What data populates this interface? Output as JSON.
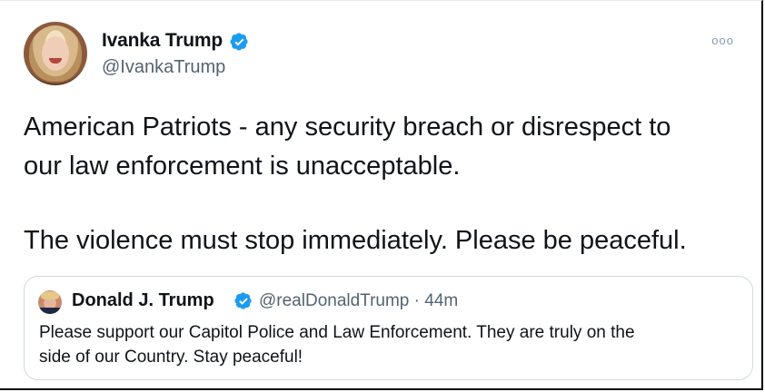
{
  "author": {
    "name": "Ivanka Trump",
    "handle": "@IvankaTrump",
    "verified": true
  },
  "more_icon": "ooo",
  "tweet": {
    "paragraph1_line1": "American Patriots - any security breach or disrespect to",
    "paragraph1_line2": "our law enforcement is unacceptable.",
    "paragraph2": "The violence must stop immediately. Please be peaceful."
  },
  "quoted_tweet": {
    "name": "Donald J. Trump",
    "handle_time": "@realDonaldTrump · 44m",
    "verified": true,
    "text_line1": "Please support our Capitol Police and Law Enforcement. They are truly on the",
    "text_line2": "side of our Country. Stay peaceful!"
  },
  "colors": {
    "verified_blue": "#1d9bf0",
    "text": "#0f1419",
    "secondary": "#536471",
    "border": "#cfd9de"
  }
}
